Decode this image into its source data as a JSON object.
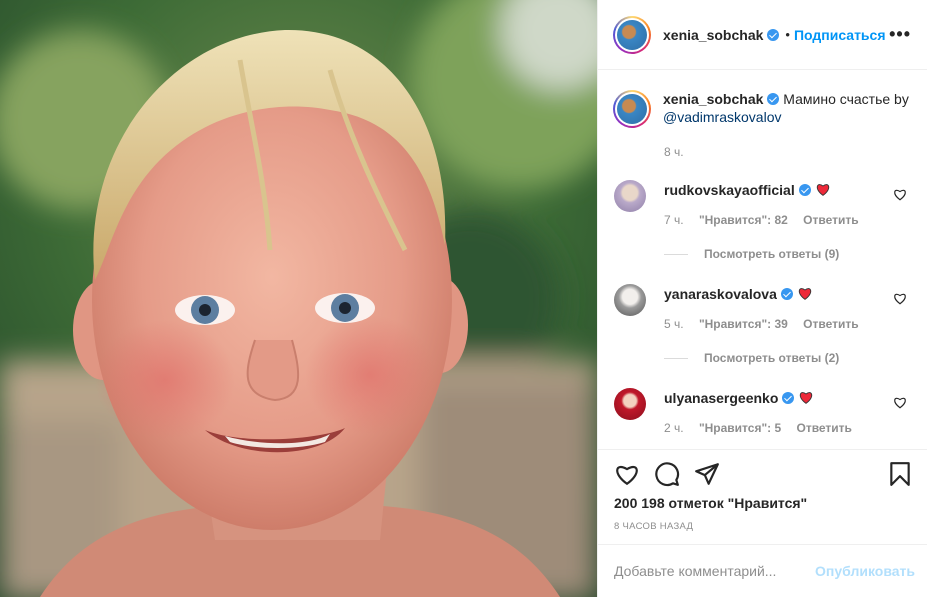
{
  "post": {
    "author": "xenia_sobchak",
    "follow_label": "Подписаться",
    "dot": "•",
    "more_label": "•••",
    "caption_text": "Мамино счастье by",
    "caption_mention": "@vadimraskovalov",
    "caption_time": "8 ч."
  },
  "comments": [
    {
      "user": "rudkovskayaofficial",
      "time": "7 ч.",
      "likes": "\"Нравится\": 82",
      "reply": "Ответить",
      "view_replies": "Посмотреть ответы (9)",
      "avatar_color": "#b9a9c9"
    },
    {
      "user": "yanaraskovalova",
      "time": "5 ч.",
      "likes": "\"Нравится\": 39",
      "reply": "Ответить",
      "view_replies": "Посмотреть ответы (2)",
      "avatar_color": "#9a9a9a"
    },
    {
      "user": "ulyanasergeenko",
      "time": "2 ч.",
      "likes": "\"Нравится\": 5",
      "reply": "Ответить",
      "avatar_color": "#c0182a"
    }
  ],
  "actions": {
    "likes_text": "200 198 отметок \"Нравится\"",
    "time_ago": "8 ЧАСОВ НАЗАД",
    "comment_placeholder": "Добавьте комментарий...",
    "publish_label": "Опубликовать"
  },
  "colors": {
    "accent": "#0095f6",
    "verified": "#3897f0",
    "heart_red": "#ed2939",
    "muted": "#8e8e8e"
  },
  "icons": [
    "verified-badge-icon",
    "more-options-icon",
    "heart-icon",
    "comment-icon",
    "share-icon",
    "bookmark-icon",
    "red-heart-emoji"
  ]
}
